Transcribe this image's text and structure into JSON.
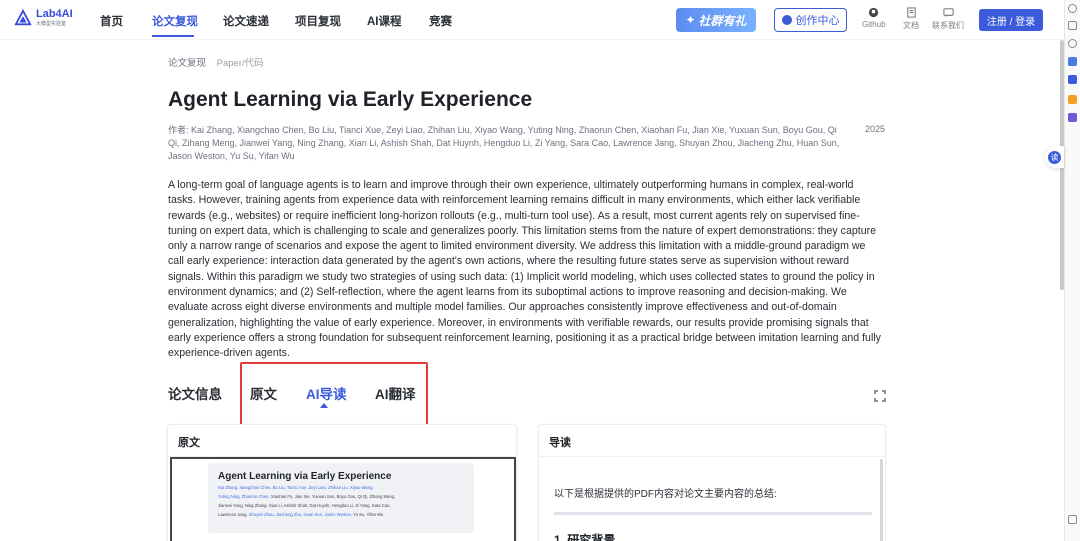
{
  "nav": {
    "logo_title": "Lab4AI",
    "logo_sub": "大模型实验室",
    "items": [
      {
        "label": "首页"
      },
      {
        "label": "论文复现"
      },
      {
        "label": "论文速递"
      },
      {
        "label": "项目复现"
      },
      {
        "label": "AI课程"
      },
      {
        "label": "竞赛"
      }
    ],
    "active_index": 1,
    "promo_label": "社群有礼",
    "create_label": "创作中心",
    "github_label": "Github",
    "docs_label": "文档",
    "contact_label": "联系我们",
    "login_label": "注册 / 登录"
  },
  "breadcrumb": {
    "root": "论文复现",
    "current": "Paper/代码"
  },
  "paper": {
    "title": "Agent Learning via Early Experience",
    "authors": "作者: Kai Zhang, Xiangchao Chen, Bo Liu, Tianci Xue, Zeyi Liao, Zhihan Liu, Xiyao Wang, Yuting Ning, Zhaorun Chen, Xiaohan Fu, Jian Xie, Yuxuan Sun, Boyu Gou, Qi Qi, Zihang Meng, Jianwei Yang, Ning Zhang, Xian Li, Ashish Shah, Dat Huynh, Hengduo Li, Zi Yang, Sara Cao, Lawrence Jang, Shuyan Zhou, Jiacheng Zhu, Huan Sun, Jason Weston, Yu Su, Yifan Wu",
    "year": "2025",
    "abstract": "A long-term goal of language agents is to learn and improve through their own experience, ultimately outperforming humans in complex, real-world tasks. However, training agents from experience data with reinforcement learning remains difficult in many environments, which either lack verifiable rewards (e.g., websites) or require inefficient long-horizon rollouts (e.g., multi-turn tool use). As a result, most current agents rely on supervised fine-tuning on expert data, which is challenging to scale and generalizes poorly. This limitation stems from the nature of expert demonstrations: they capture only a narrow range of scenarios and expose the agent to limited environment diversity. We address this limitation with a middle-ground paradigm we call early experience: interaction data generated by the agent's own actions, where the resulting future states serve as supervision without reward signals. Within this paradigm we study two strategies of using such data: (1) Implicit world modeling, which uses collected states to ground the policy in environment dynamics; and (2) Self-reflection, where the agent learns from its suboptimal actions to improve reasoning and decision-making. We evaluate across eight diverse environments and multiple model families. Our approaches consistently improve effectiveness and out-of-domain generalization, highlighting the value of early experience. Moreover, in environments with verifiable rewards, our results provide promising signals that early experience offers a strong foundation for subsequent reinforcement learning, positioning it as a practical bridge between imitation learning and fully experience-driven agents."
  },
  "tabs": {
    "info_label": "论文信息",
    "items": [
      {
        "label": "原文"
      },
      {
        "label": "AI导读"
      },
      {
        "label": "AI翻译"
      }
    ],
    "active_index": 1
  },
  "left_panel": {
    "heading": "原文",
    "pdf_title": "Agent Learning via Early Experience",
    "pdf_authors_line1_blue": "Kai Zhang, Xiangchao Chen, Bo Liu, Tianci Xue, Zeyi Liao, Zhihan Liu, Xiyao Wang,",
    "pdf_authors_line2a_blue": "Yuting Ning, Zhaorun Chen,",
    "pdf_authors_line2b": "Xiaohan Fu, Jian Xie, Yuxuan Sun, Boyu Gou, Qi Qi, Zihang Meng,",
    "pdf_authors_line3": "Jianwei Yang, Ning Zhang, Xian Li, Ashish Shah, Dat Huynh, Hengduo Li, Zi Yang, Sara Cao,",
    "pdf_authors_line4a": "Lawrence Jang,",
    "pdf_authors_line4b_blue": "Shuyan Zhou, Jiacheng Zhu, Huan Sun, Jason Weston,",
    "pdf_authors_line4c": "Yu Su, Yifan Wu"
  },
  "right_panel": {
    "heading": "导读",
    "intro": "以下是根据提供的PDF内容对论文主要内容的总结:",
    "section_heading": "1. 研究背景"
  },
  "colors": {
    "accent": "#3b5bdb",
    "highlight_box": "#e03c3c"
  }
}
